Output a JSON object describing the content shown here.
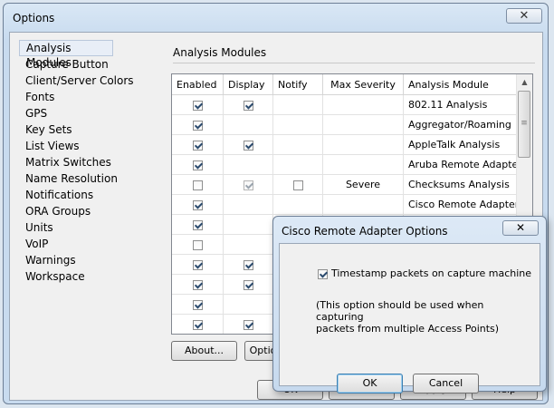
{
  "window": {
    "title": "Options",
    "close_glyph": "✕"
  },
  "nav": {
    "items": [
      "Analysis Modules",
      "Capture Button",
      "Client/Server Colors",
      "Fonts",
      "GPS",
      "Key Sets",
      "List Views",
      "Matrix Switches",
      "Name Resolution",
      "Notifications",
      "ORA Groups",
      "Units",
      "VoIP",
      "Warnings",
      "Workspace"
    ],
    "selected_index": 0
  },
  "section": {
    "title": "Analysis Modules"
  },
  "grid": {
    "columns": [
      "Enabled",
      "Display",
      "Notify",
      "Max Severity",
      "Analysis Module"
    ],
    "rows": [
      {
        "enabled": true,
        "display": true,
        "notify": null,
        "severity": "",
        "module": "802.11 Analysis"
      },
      {
        "enabled": true,
        "display": null,
        "notify": null,
        "severity": "",
        "module": "Aggregator/Roaming"
      },
      {
        "enabled": true,
        "display": true,
        "notify": null,
        "severity": "",
        "module": "AppleTalk Analysis"
      },
      {
        "enabled": true,
        "display": null,
        "notify": null,
        "severity": "",
        "module": "Aruba Remote Adapter"
      },
      {
        "enabled": false,
        "display": true,
        "notify": false,
        "severity": "Severe",
        "module": "Checksums Analysis"
      },
      {
        "enabled": true,
        "display": null,
        "notify": null,
        "severity": "",
        "module": "Cisco Remote Adapter"
      },
      {
        "enabled": true,
        "display": null,
        "notify": null,
        "severity": "",
        "module": ""
      },
      {
        "enabled": false,
        "display": null,
        "notify": null,
        "severity": "",
        "module": ""
      },
      {
        "enabled": true,
        "display": true,
        "notify": null,
        "severity": "",
        "module": ""
      },
      {
        "enabled": true,
        "display": true,
        "notify": null,
        "severity": "",
        "module": ""
      },
      {
        "enabled": true,
        "display": null,
        "notify": null,
        "severity": "",
        "module": ""
      },
      {
        "enabled": true,
        "display": true,
        "notify": null,
        "severity": "",
        "module": ""
      }
    ]
  },
  "buttons": {
    "about": "About...",
    "options": "Optio",
    "ok": "OK",
    "cancel": "Cancel",
    "apply": "Apply",
    "help": "Help"
  },
  "dialog": {
    "title": "Cisco Remote Adapter Options",
    "close_glyph": "✕",
    "checkbox_label": "Timestamp packets on capture machine",
    "checkbox_checked": true,
    "note_line1": "(This option should be used when capturing",
    "note_line2": "packets from multiple Access Points)",
    "ok": "OK",
    "cancel": "Cancel"
  },
  "scrollbar": {
    "up": "▲",
    "grip": "≡"
  }
}
